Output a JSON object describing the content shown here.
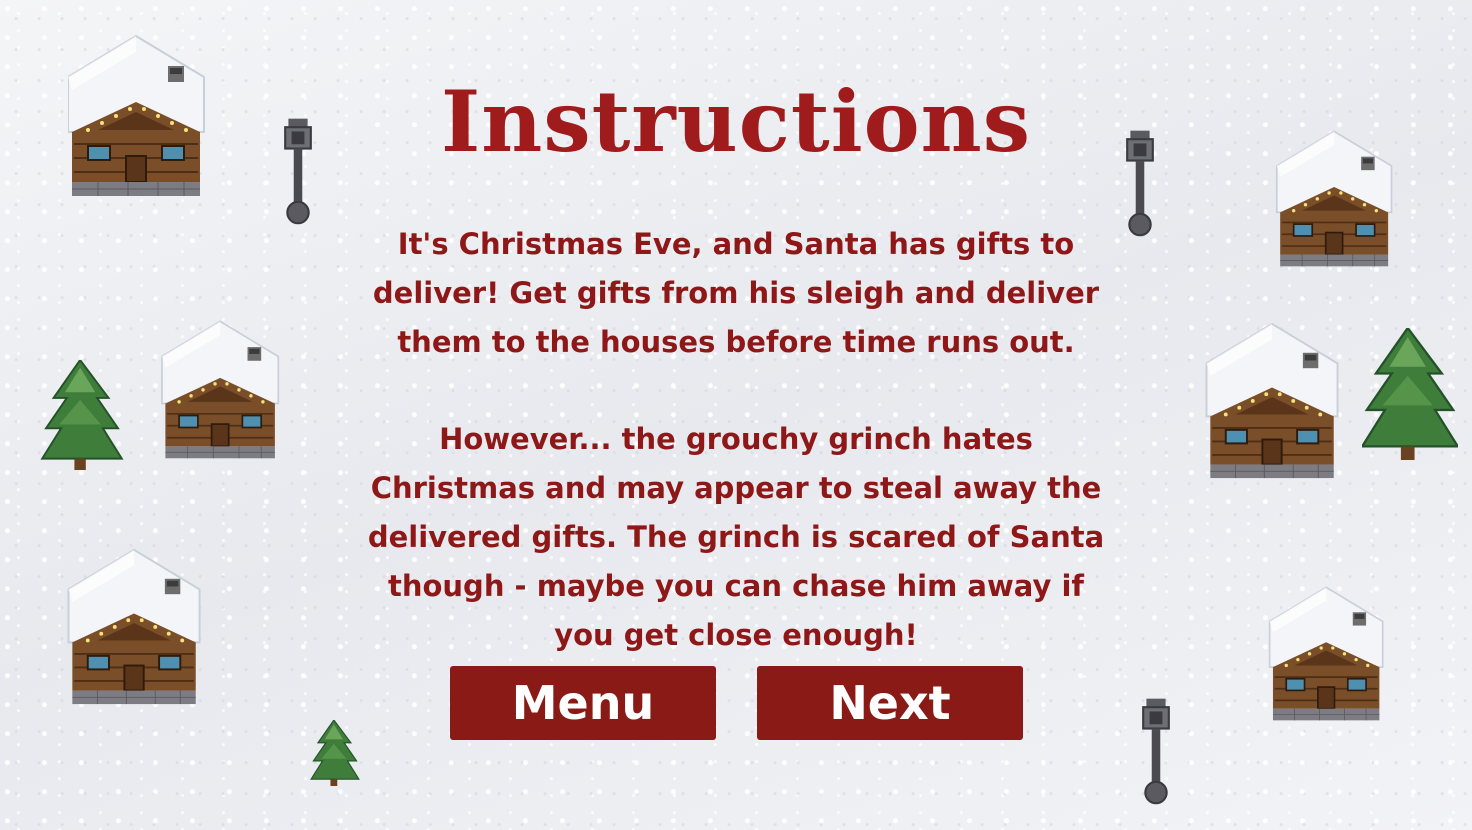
{
  "screen": {
    "title": "Instructions",
    "paragraph1": "It's Christmas Eve, and Santa has gifts to deliver! Get gifts from his sleigh and deliver them to the houses before time runs out.",
    "paragraph2": "However... the grouchy grinch hates Christmas and may appear to steal away the delivered gifts. The grinch is scared of Santa though - maybe you can chase him away if you get close enough!"
  },
  "buttons": {
    "menu_label": "Menu",
    "next_label": "Next"
  },
  "colors": {
    "title": "#a01c1c",
    "text": "#8e1818",
    "button_bg": "#8a1a15",
    "button_text": "#ffffff",
    "snow": "#eef0f3"
  },
  "decorations": {
    "house_icon": "snowy-cabin-icon",
    "tree_icon": "pine-tree-icon",
    "lamp_icon": "street-lamp-icon"
  }
}
